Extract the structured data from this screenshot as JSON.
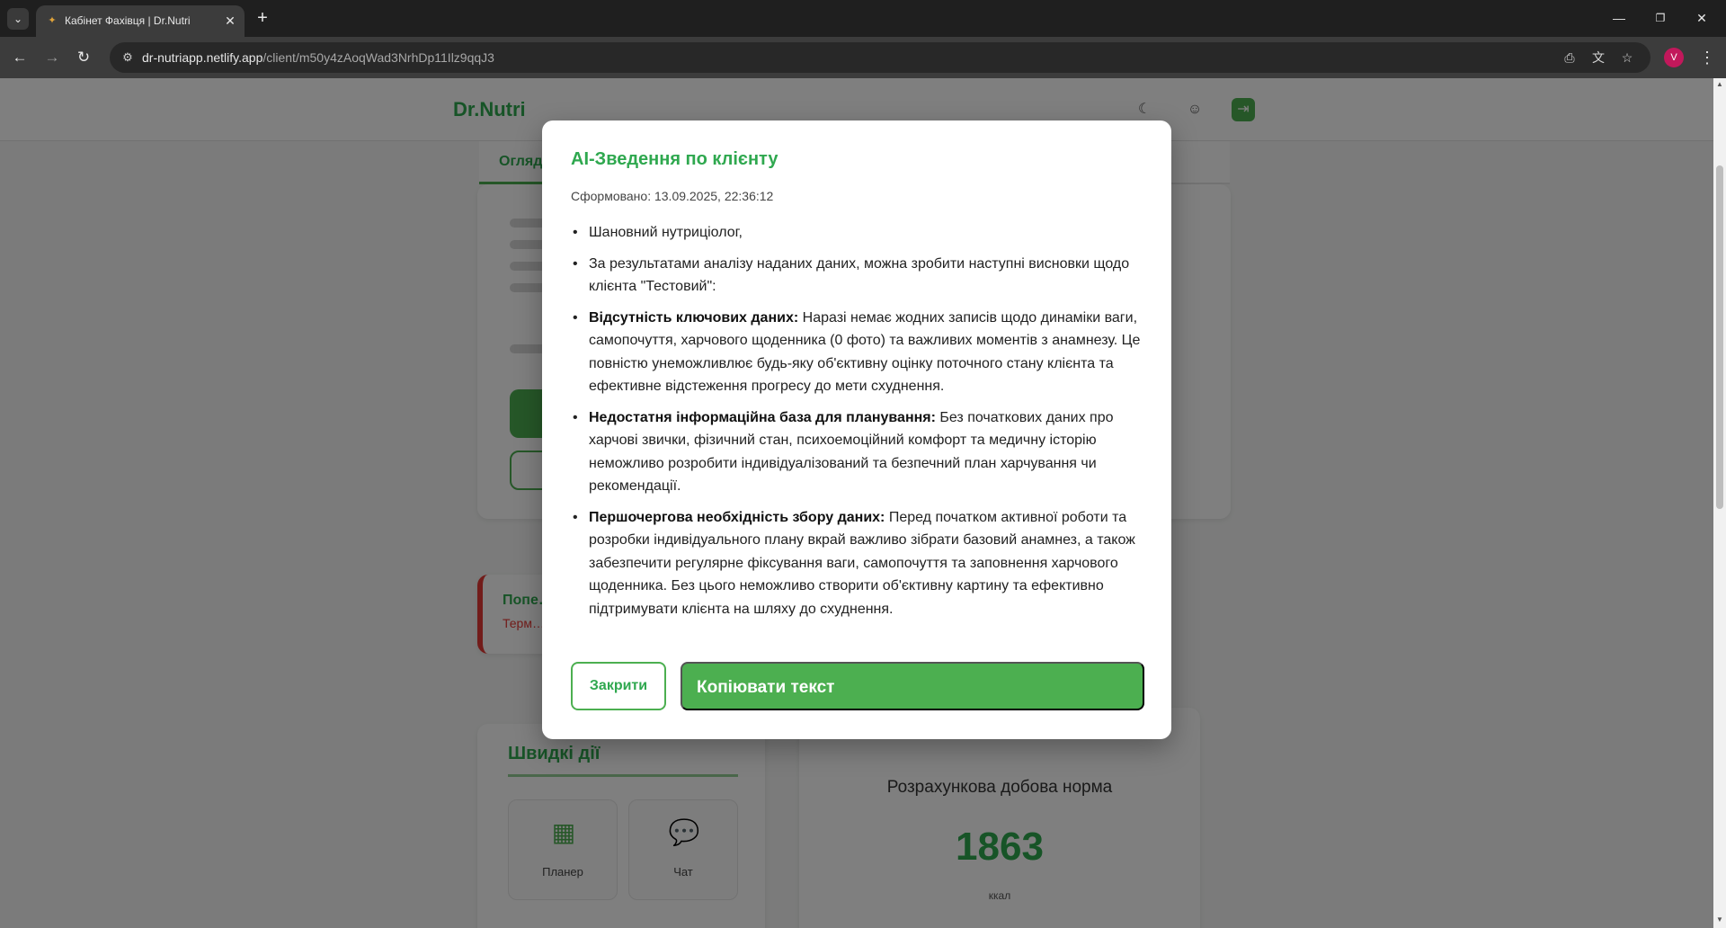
{
  "browser": {
    "tab_title": "Кабінет Фахівця | Dr.Nutri",
    "url_host": "dr-nutriapp.netlify.app",
    "url_path": "/client/m50y4zAoqWad3NrhDp11Ilz9qqJ3",
    "profile_initial": "V",
    "icons": {
      "tab_list": "chevron-down-icon",
      "favicon": "favicon-icon",
      "tab_close": "close-icon",
      "new_tab": "plus-icon",
      "back": "arrow-left-icon",
      "forward": "arrow-right-icon",
      "reload": "reload-icon",
      "site_info": "tune-icon",
      "install": "install-app-icon",
      "translate": "translate-icon",
      "bookmark": "star-icon",
      "menu": "kebab-menu-icon",
      "minimize": "minimize-icon",
      "restore": "restore-icon",
      "close_window": "close-icon"
    }
  },
  "app": {
    "logo": "Dr.Nutri",
    "active_tab": "Огляд",
    "alert": {
      "title": "Попе…",
      "subtitle": "Терм…"
    },
    "quick": {
      "title": "Швидкі дії",
      "tiles": [
        {
          "label": "Планер",
          "icon": "calendar-icon"
        },
        {
          "label": "Чат",
          "icon": "chat-icon"
        }
      ]
    },
    "calories": {
      "title": "Розрахункова добова норма",
      "value": "1863",
      "unit": "ккал"
    }
  },
  "modal": {
    "title": "AI-Зведення по клієнту",
    "generated": "Сформовано: 13.09.2025, 22:36:12",
    "items": [
      {
        "bold": "",
        "text": "Шановний нутриціолог,"
      },
      {
        "bold": "",
        "text": "За результатами аналізу наданих даних, можна зробити наступні висновки щодо клієнта \"Тестовий\":"
      },
      {
        "bold": "Відсутність ключових даних:",
        "text": " Наразі немає жодних записів щодо динаміки ваги, самопочуття, харчового щоденника (0 фото) та важливих моментів з анамнезу. Це повністю унеможливлює будь-яку об'єктивну оцінку поточного стану клієнта та ефективне відстеження прогресу до мети схуднення."
      },
      {
        "bold": "Недостатня інформаційна база для планування:",
        "text": " Без початкових даних про харчові звички, фізичний стан, психоемоційний комфорт та медичну історію неможливо розробити індивідуалізований та безпечний план харчування чи рекомендації."
      },
      {
        "bold": "Першочергова необхідність збору даних:",
        "text": " Перед початком активної роботи та розробки індивідуального плану вкрай важливо зібрати базовий анамнез, а також забезпечити регулярне фіксування ваги, самопочуття та заповнення харчового щоденника. Без цього неможливо створити об'єктивну картину та ефективно підтримувати клієнта на шляху до схуднення."
      }
    ],
    "close_label": "Закрити",
    "copy_label": "Копіювати текст"
  },
  "colors": {
    "accent": "#4caf50",
    "accent_text": "#2fa84f",
    "alert": "#e53935",
    "profile": "#c2185b"
  }
}
